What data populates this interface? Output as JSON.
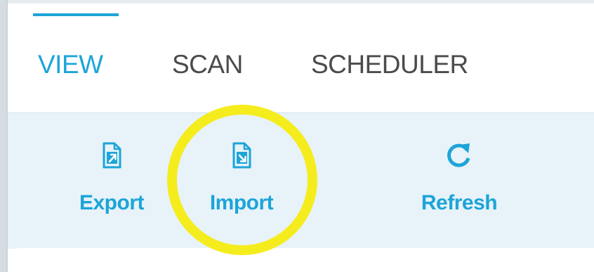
{
  "tabs": {
    "view": "VIEW",
    "scan": "SCAN",
    "scheduler": "SCHEDULER",
    "active": "VIEW"
  },
  "toolbar": {
    "export_label": "Export",
    "import_label": "Import",
    "refresh_label": "Refresh"
  },
  "icons": {
    "export": "export-icon",
    "import": "import-icon",
    "refresh": "refresh-icon"
  },
  "colors": {
    "accent": "#1da4d8",
    "tab_inactive": "#4b4b4b",
    "toolbar_bg": "#e7f3f9",
    "highlight": "#f5ec1e"
  }
}
